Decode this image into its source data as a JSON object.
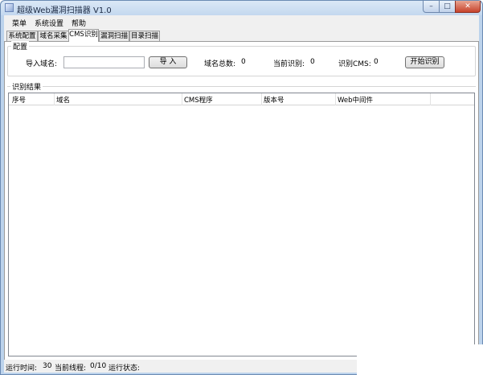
{
  "window": {
    "title": "超级Web漏洞扫描器 V1.0",
    "controls": {
      "minimize": "–",
      "maximize": "□",
      "close": "✕"
    }
  },
  "menu": [
    "菜单",
    "系统设置",
    "帮助"
  ],
  "tabs": [
    {
      "label": "系统配置",
      "active": false
    },
    {
      "label": "域名采集",
      "active": false
    },
    {
      "label": "CMS识别",
      "active": true
    },
    {
      "label": "漏洞扫描",
      "active": false
    },
    {
      "label": "目录扫描",
      "active": false
    }
  ],
  "config": {
    "group_title": "配置",
    "import_label": "导入域名:",
    "import_value": "",
    "import_button": "导 入",
    "total_label": "域名总数:",
    "total_value": "0",
    "current_label": "当前识别:",
    "current_value": "0",
    "cms_label": "识别CMS:",
    "cms_value": "0",
    "start_button": "开始识别"
  },
  "results": {
    "group_title": "识别结果",
    "columns": [
      "序号",
      "域名",
      "CMS程序",
      "版本号",
      "Web中间件"
    ],
    "rows": []
  },
  "status": {
    "runtime_label": "运行时间:",
    "runtime_value": "30",
    "threads_label": "当前线程:",
    "threads_value": "0/10",
    "state_label": "运行状态:",
    "state_value": ""
  }
}
